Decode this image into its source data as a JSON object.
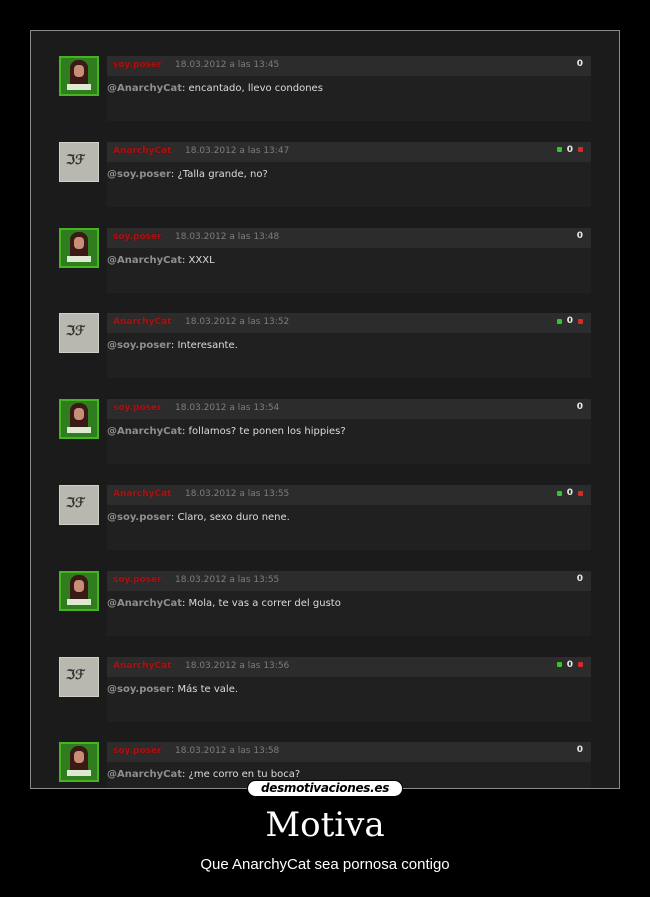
{
  "site": {
    "logo_text": "desmotivaciones.es"
  },
  "poster": {
    "title": "Motiva",
    "caption": "Que AnarchyCat sea pornosa contigo"
  },
  "colors": {
    "username_red": "#a11616",
    "vote_up": "#2ec92e",
    "vote_down": "#d72b2b",
    "avatar_green": "#46b321"
  },
  "comments": [
    {
      "user": "soy.poser",
      "avatar": "green-avatar",
      "date": "18.03.2012 a las 13:45",
      "score": "0",
      "votes": false,
      "mention": "@AnarchyCat",
      "text": ": encantado, llevo condones"
    },
    {
      "user": "AnarchyCat",
      "avatar": "grey-avatar",
      "date": "18.03.2012 a las 13:47",
      "score": "0",
      "votes": true,
      "mention": "@soy.poser",
      "text": ": ¿Talla grande, no?"
    },
    {
      "user": "soy.poser",
      "avatar": "green-avatar",
      "date": "18.03.2012 a las 13:48",
      "score": "0",
      "votes": false,
      "mention": "@AnarchyCat",
      "text": ": XXXL"
    },
    {
      "user": "AnarchyCat",
      "avatar": "grey-avatar",
      "date": "18.03.2012 a las 13:52",
      "score": "0",
      "votes": true,
      "mention": "@soy.poser",
      "text": ": Interesante."
    },
    {
      "user": "soy.poser",
      "avatar": "green-avatar",
      "date": "18.03.2012 a las 13:54",
      "score": "0",
      "votes": false,
      "mention": "@AnarchyCat",
      "text": ": follamos? te ponen los hippies?"
    },
    {
      "user": "AnarchyCat",
      "avatar": "grey-avatar",
      "date": "18.03.2012 a las 13:55",
      "score": "0",
      "votes": true,
      "mention": "@soy.poser",
      "text": ": Claro, sexo duro nene."
    },
    {
      "user": "soy.poser",
      "avatar": "green-avatar",
      "date": "18.03.2012 a las 13:55",
      "score": "0",
      "votes": false,
      "mention": "@AnarchyCat",
      "text": ": Mola, te vas a correr del gusto"
    },
    {
      "user": "AnarchyCat",
      "avatar": "grey-avatar",
      "date": "18.03.2012 a las 13:56",
      "score": "0",
      "votes": true,
      "mention": "@soy.poser",
      "text": ": Más te vale."
    },
    {
      "user": "soy.poser",
      "avatar": "green-avatar",
      "date": "18.03.2012 a las 13:58",
      "score": "0",
      "votes": false,
      "mention": "@AnarchyCat",
      "text": ": ¿me corro en tu boca?"
    }
  ]
}
